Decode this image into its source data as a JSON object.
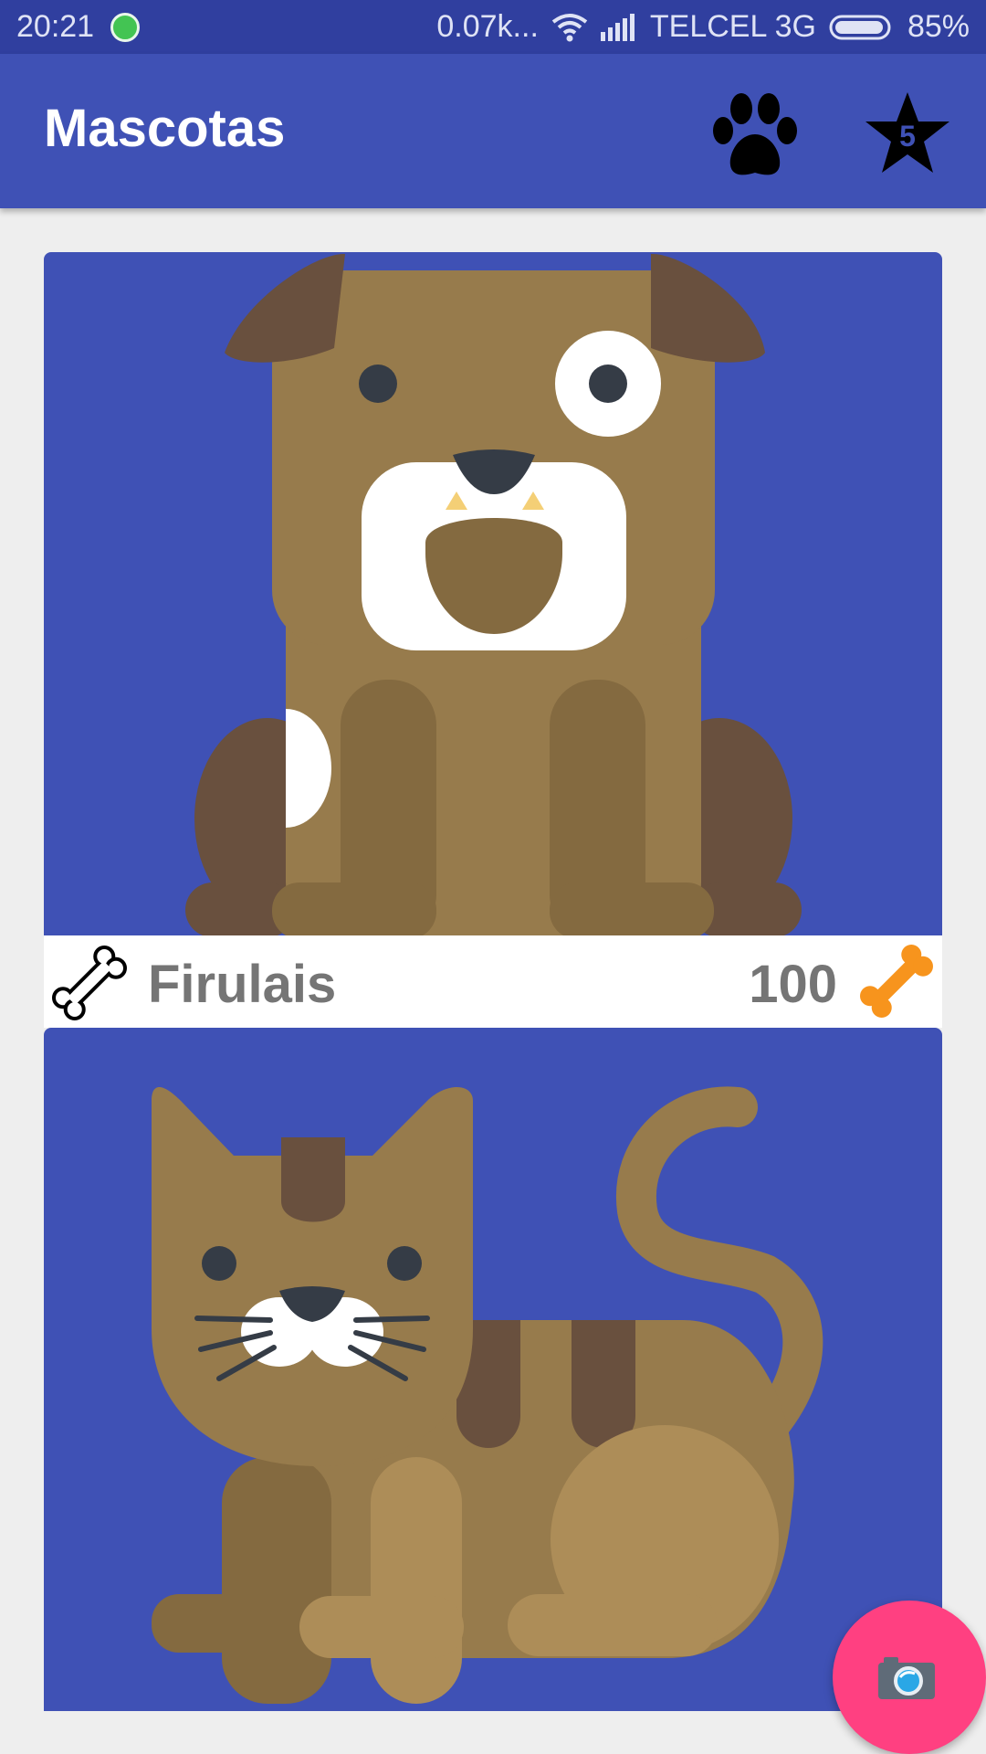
{
  "status_bar": {
    "time": "20:21",
    "network_speed": "0.07k...",
    "carrier": "TELCEL 3G",
    "battery": "85%",
    "notification_icon": "whatsapp-icon"
  },
  "app_bar": {
    "title": "Mascotas",
    "actions": [
      {
        "icon": "paw-icon"
      },
      {
        "icon": "star-icon",
        "badge": "5"
      }
    ]
  },
  "pets": [
    {
      "name": "Firulais",
      "rating": "100",
      "animal": "dog"
    },
    {
      "animal": "cat"
    }
  ],
  "fab": {
    "icon": "camera-icon",
    "color": "#ff4081"
  },
  "colors": {
    "primary": "#3f51b5",
    "primary_dark": "#303f9f",
    "accent": "#ff4081",
    "bone_orange": "#f7941d"
  }
}
